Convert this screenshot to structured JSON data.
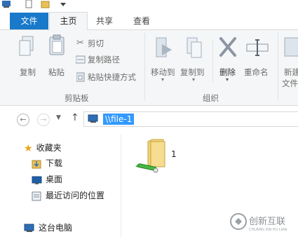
{
  "tabs": {
    "file": "文件",
    "home": "主页",
    "share": "共享",
    "view": "查看"
  },
  "ribbon": {
    "clipboard": {
      "copy": "复制",
      "paste": "粘贴",
      "cut": "剪切",
      "copy_path": "复制路径",
      "paste_shortcut": "粘贴快捷方式",
      "group": "剪贴板"
    },
    "organize": {
      "move_to": "移动到",
      "copy_to": "复制到",
      "delete": "删除",
      "rename": "重命名",
      "group": "组织"
    },
    "new": {
      "new_folder_line1": "新建",
      "new_folder_line2": "文件"
    }
  },
  "address": {
    "path": "\\\\file-1"
  },
  "navpane": {
    "favorites": "收藏夹",
    "downloads": "下载",
    "desktop": "桌面",
    "recent": "最近访问的位置",
    "this_pc": "这台电脑"
  },
  "content": {
    "items": [
      {
        "name": "1",
        "icon": "shared-folder-icon"
      }
    ]
  },
  "watermark": {
    "brand": "创新互联",
    "sub": "CHUANG XIN HU LIAN"
  },
  "colors": {
    "file_tab": "#1979ca",
    "selection": "#3399ff",
    "ribbon_bg": "#f5f6f7"
  }
}
